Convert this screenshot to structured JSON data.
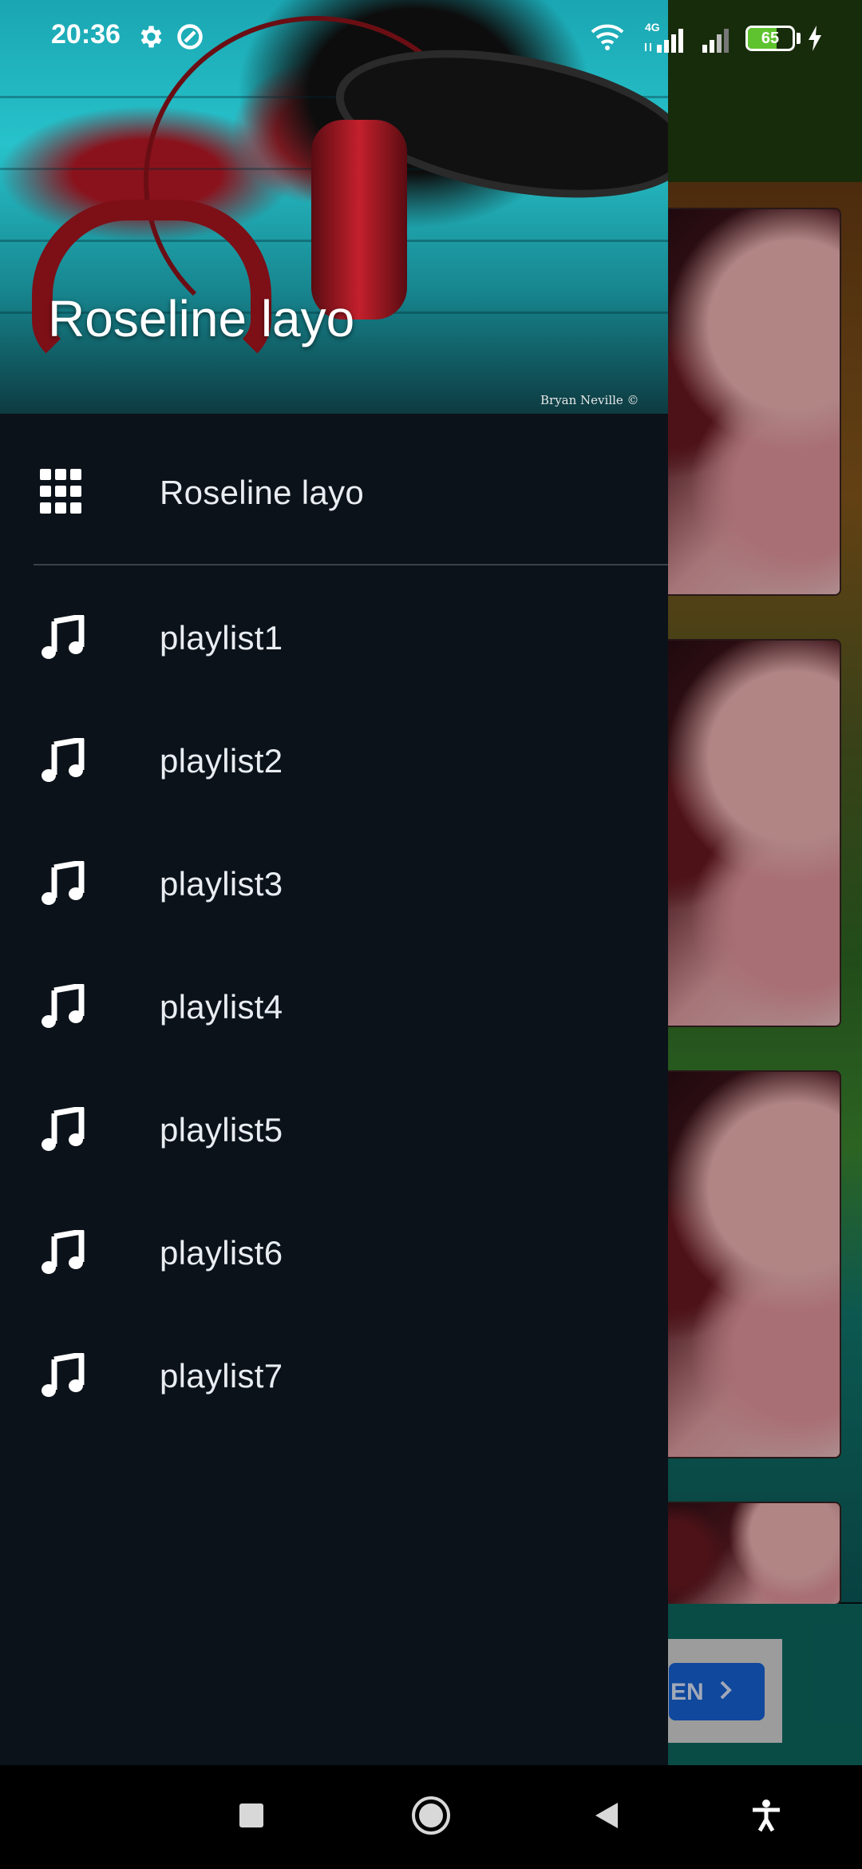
{
  "status_bar": {
    "time": "20:36",
    "network_label": "4G",
    "battery_level": "65",
    "battery_percent": 65,
    "icons": [
      "settings-icon",
      "sync-icon",
      "wifi-icon",
      "signal-4g-icon",
      "signal-icon",
      "battery-icon",
      "charging-icon"
    ]
  },
  "drawer": {
    "header": {
      "title": "Roseline layo",
      "watermark": "Bryan Neville ©"
    },
    "home_item": {
      "label": "Roseline layo",
      "icon": "grid-icon"
    },
    "playlists": [
      {
        "label": "playlist1",
        "icon": "music-note-icon"
      },
      {
        "label": "playlist2",
        "icon": "music-note-icon"
      },
      {
        "label": "playlist3",
        "icon": "music-note-icon"
      },
      {
        "label": "playlist4",
        "icon": "music-note-icon"
      },
      {
        "label": "playlist5",
        "icon": "music-note-icon"
      },
      {
        "label": "playlist6",
        "icon": "music-note-icon"
      },
      {
        "label": "playlist7",
        "icon": "music-note-icon"
      }
    ]
  },
  "background": {
    "ad_button_label": "EN"
  },
  "nav_bar": {
    "buttons": [
      "recents-icon",
      "home-icon",
      "back-icon",
      "accessibility-icon"
    ]
  },
  "colors": {
    "drawer_bg": "#0b1219",
    "battery_fill": "#5ec32e",
    "ad_button": "#1565d8"
  }
}
